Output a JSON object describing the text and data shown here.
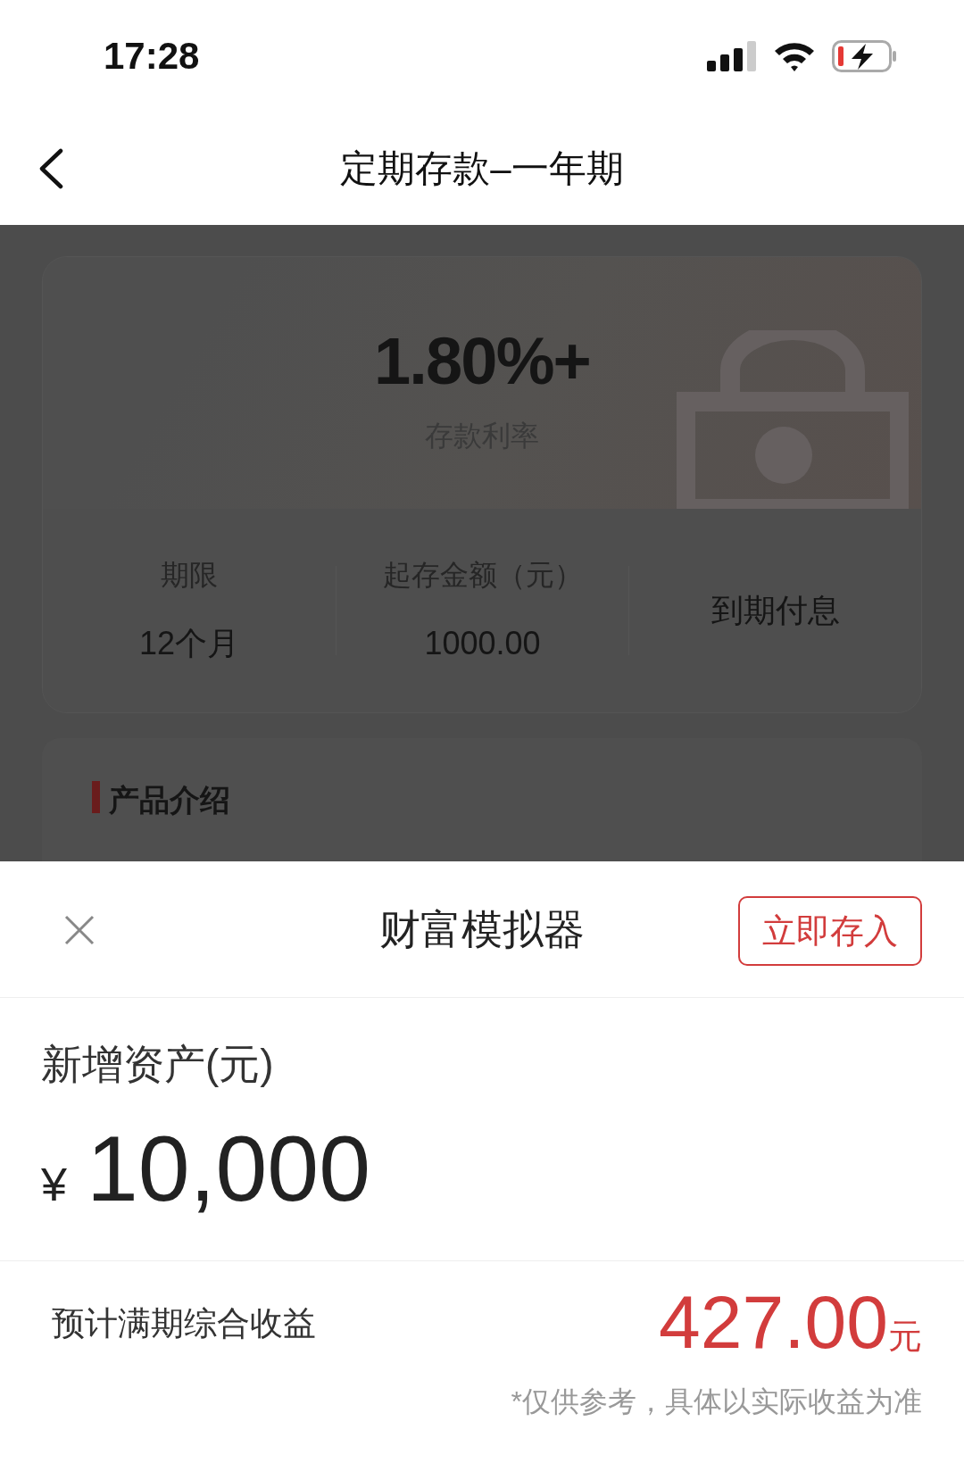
{
  "status_bar": {
    "time": "17:28"
  },
  "nav": {
    "title": "定期存款–一年期"
  },
  "rate_card": {
    "rate": "1.80%+",
    "rate_label": "存款利率"
  },
  "terms": [
    {
      "label": "期限",
      "value": "12个月"
    },
    {
      "label": "起存金额（元）",
      "value": "1000.00"
    },
    {
      "value": "到期付息"
    }
  ],
  "section": {
    "title": "产品介绍"
  },
  "sheet": {
    "title": "财富模拟器",
    "action": "立即存入",
    "field_label": "新增资产(元)",
    "currency": "¥",
    "amount": "10,000",
    "result_label": "预计满期综合收益",
    "result_value": "427.00",
    "result_unit": "元",
    "note": "*仅供参考，具体以实际收益为准"
  }
}
